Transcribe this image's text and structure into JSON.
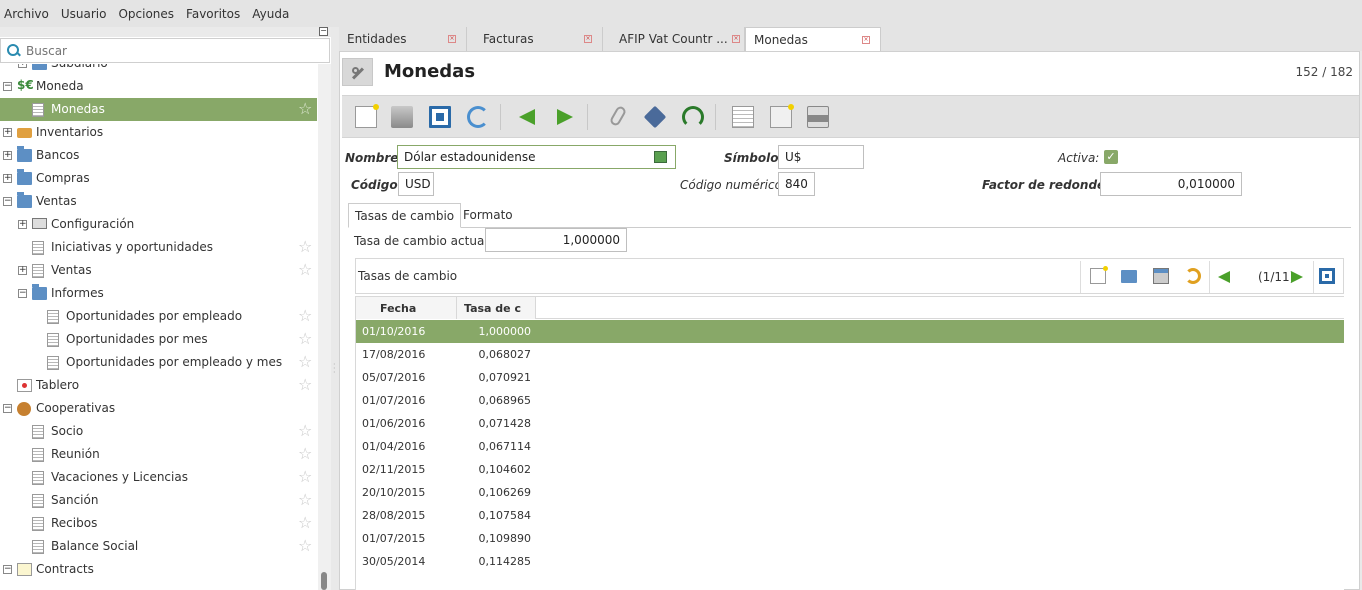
{
  "menubar": [
    "Archivo",
    "Usuario",
    "Opciones",
    "Favoritos",
    "Ayuda"
  ],
  "sidebar": {
    "search_placeholder": "Buscar",
    "tree": [
      {
        "label": "Subdiario",
        "level": 1,
        "icon": "folder",
        "expander": "+",
        "cut": true
      },
      {
        "label": "Moneda",
        "level": 0,
        "icon": "money",
        "expander": "-"
      },
      {
        "label": "Monedas",
        "level": 1,
        "icon": "doc",
        "star": true,
        "selected": true
      },
      {
        "label": "Inventarios",
        "level": 0,
        "icon": "inventory",
        "expander": "+"
      },
      {
        "label": "Bancos",
        "level": 0,
        "icon": "folder",
        "expander": "+"
      },
      {
        "label": "Compras",
        "level": 0,
        "icon": "folder",
        "expander": "+"
      },
      {
        "label": "Ventas",
        "level": 0,
        "icon": "folder",
        "expander": "-"
      },
      {
        "label": "Configuración",
        "level": 1,
        "icon": "config",
        "expander": "+"
      },
      {
        "label": "Iniciativas y oportunidades",
        "level": 1,
        "icon": "doc",
        "star": true
      },
      {
        "label": "Ventas",
        "level": 1,
        "icon": "doc",
        "expander": "+",
        "star": true
      },
      {
        "label": "Informes",
        "level": 1,
        "icon": "folder",
        "expander": "-"
      },
      {
        "label": "Oportunidades por empleado",
        "level": 2,
        "icon": "doc",
        "star": true
      },
      {
        "label": "Oportunidades por mes",
        "level": 2,
        "icon": "doc",
        "star": true
      },
      {
        "label": "Oportunidades por empleado y mes",
        "level": 2,
        "icon": "doc",
        "star": true
      },
      {
        "label": "Tablero",
        "level": 0,
        "icon": "board",
        "star": true
      },
      {
        "label": "Cooperativas",
        "level": 0,
        "icon": "coop",
        "expander": "-"
      },
      {
        "label": "Socio",
        "level": 1,
        "icon": "doc",
        "star": true
      },
      {
        "label": "Reunión",
        "level": 1,
        "icon": "doc",
        "star": true
      },
      {
        "label": "Vacaciones y Licencias",
        "level": 1,
        "icon": "doc",
        "star": true
      },
      {
        "label": "Sanción",
        "level": 1,
        "icon": "doc",
        "star": true
      },
      {
        "label": "Recibos",
        "level": 1,
        "icon": "doc",
        "star": true
      },
      {
        "label": "Balance Social",
        "level": 1,
        "icon": "doc",
        "star": true
      },
      {
        "label": "Contracts",
        "level": 0,
        "icon": "contract",
        "expander": "-"
      }
    ]
  },
  "tabs": [
    {
      "label": "Entidades",
      "active": false
    },
    {
      "label": "Facturas",
      "active": false
    },
    {
      "label": "AFIP Vat Countr ...",
      "active": false
    },
    {
      "label": "Monedas",
      "active": true
    }
  ],
  "form": {
    "title": "Monedas",
    "record_counter": "152 / 182",
    "nombre_label": "Nombre:",
    "nombre_value": "Dólar estadounidense",
    "simbolo_label": "Símbolo:",
    "simbolo_value": "U$",
    "activa_label": "Activa:",
    "activa_checked": true,
    "codigo_label": "Código:",
    "codigo_value": "USD",
    "codigo_numerico_label": "Código numérico:",
    "codigo_numerico_value": "840",
    "factor_label": "Factor de redondeo:",
    "factor_value": "0,010000",
    "form_tabs": [
      "Tasas de cambio",
      "Formato"
    ],
    "tasa_actual_label": "Tasa de cambio actual:",
    "tasa_actual_value": "1,000000"
  },
  "grid": {
    "title": "Tasas de cambio",
    "pager": "(1/11)",
    "columns": [
      "Fecha",
      "Tasa de c"
    ],
    "rows": [
      {
        "fecha": "01/10/2016",
        "tasa": "1,000000",
        "selected": true
      },
      {
        "fecha": "17/08/2016",
        "tasa": "0,068027"
      },
      {
        "fecha": "05/07/2016",
        "tasa": "0,070921"
      },
      {
        "fecha": "01/07/2016",
        "tasa": "0,068965"
      },
      {
        "fecha": "01/06/2016",
        "tasa": "0,071428"
      },
      {
        "fecha": "01/04/2016",
        "tasa": "0,067114"
      },
      {
        "fecha": "02/11/2015",
        "tasa": "0,104602"
      },
      {
        "fecha": "20/10/2015",
        "tasa": "0,106269"
      },
      {
        "fecha": "28/08/2015",
        "tasa": "0,107584"
      },
      {
        "fecha": "01/07/2015",
        "tasa": "0,109890"
      },
      {
        "fecha": "30/05/2014",
        "tasa": "0,114285"
      }
    ]
  },
  "colors": {
    "accent": "#88a868",
    "toolbar_bg": "#e3e3e3"
  }
}
